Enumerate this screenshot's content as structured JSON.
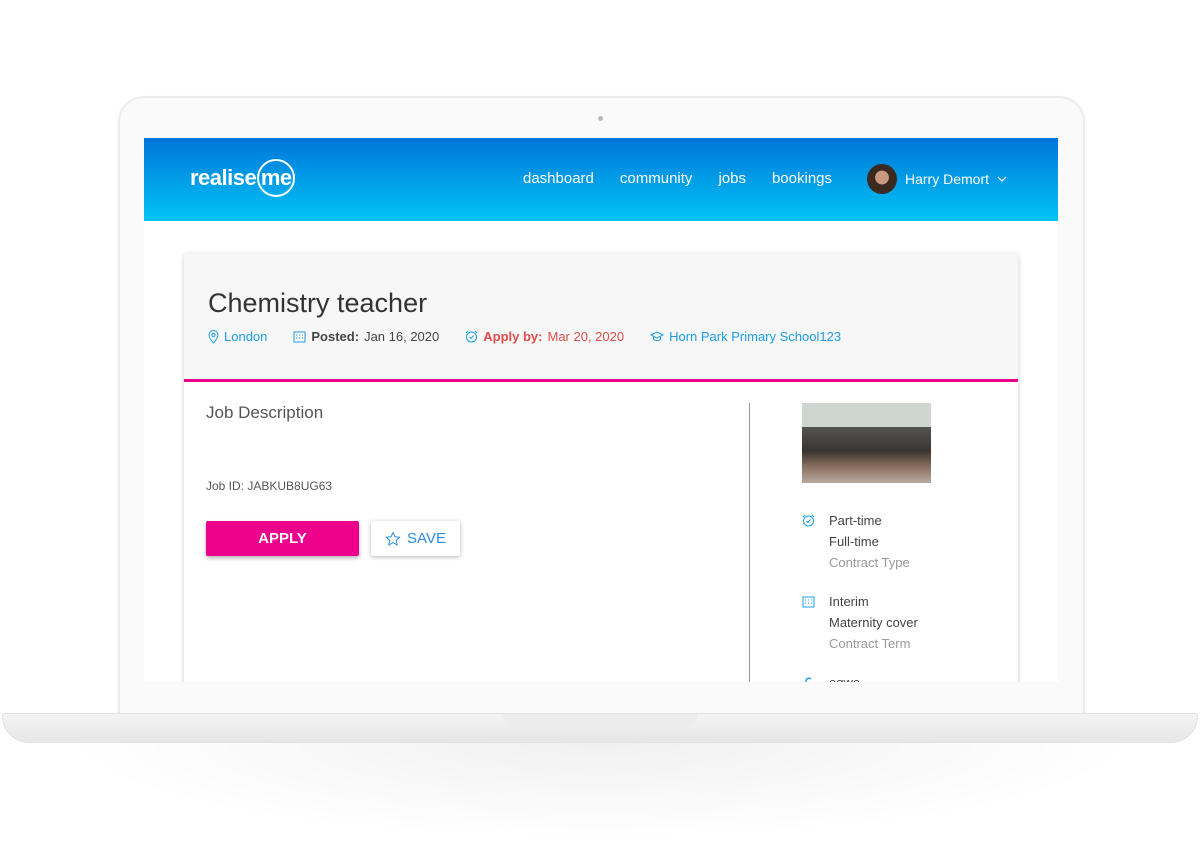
{
  "nav": {
    "logo": "realise",
    "logo_ring": "me",
    "links": [
      "dashboard",
      "community",
      "jobs",
      "bookings"
    ],
    "user": "Harry Demort"
  },
  "job": {
    "title": "Chemistry teacher",
    "location": "London",
    "posted_label": "Posted:",
    "posted": "Jan 16, 2020",
    "apply_label": "Apply by:",
    "apply_by": "Mar 20, 2020",
    "school": "Horn Park Primary School123"
  },
  "main": {
    "heading": "Job Description",
    "job_id": "Job ID: JABKUB8UG63",
    "apply": "APPLY",
    "save": "SAVE"
  },
  "side": {
    "contract_type": {
      "values": [
        "Part-time",
        "Full-time"
      ],
      "label": "Contract Type"
    },
    "contract_term": {
      "values": [
        "Interim",
        "Maternity cover"
      ],
      "label": "Contract Term"
    },
    "salary": {
      "value": "eqwe"
    }
  },
  "colors": {
    "accent": "#ec008c",
    "link": "#1a9ee8",
    "deadline": "#e04b4b",
    "nav_top": "#0075d9",
    "nav_bottom": "#00c4f4"
  }
}
